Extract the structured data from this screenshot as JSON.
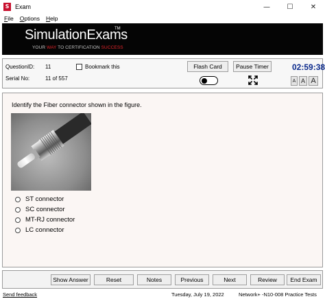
{
  "window": {
    "title": "Exam",
    "app_icon": "S",
    "controls": {
      "minimize": "—",
      "maximize": "☐",
      "close": "✕"
    }
  },
  "menu": {
    "items": [
      {
        "mnemonic": "F",
        "rest": "ile"
      },
      {
        "mnemonic": "O",
        "rest": "ptions"
      },
      {
        "mnemonic": "H",
        "rest": "elp"
      }
    ]
  },
  "banner": {
    "brand": "SimulationExams",
    "trademark": "TM",
    "tagline_part1": "YOUR ",
    "tagline_way": "WAY",
    "tagline_part2": " TO CERTIFICATION ",
    "tagline_success": "SUCCESS",
    "accent_color": "#e8262b"
  },
  "info": {
    "question_id_label": "QuestionID:",
    "question_id_value": "11",
    "serial_label": "Serial No:",
    "serial_value": "11 of 557",
    "bookmark_label": "Bookmark this",
    "bookmark_checked": false,
    "flash_card_label": "Flash Card",
    "pause_timer_label": "Pause Timer",
    "timer": "02:59:38",
    "timer_color": "#0b2a8c",
    "font_sizes": [
      "A",
      "A",
      "A"
    ]
  },
  "question": {
    "text": "Identify the Fiber connector shown in the figure.",
    "image_icon": "fiber-connector-photo",
    "options": [
      {
        "label": "ST connector"
      },
      {
        "label": "SC connector"
      },
      {
        "label": "MT-RJ connector"
      },
      {
        "label": "LC connector"
      }
    ]
  },
  "buttons": {
    "show_answer": "Show Answer",
    "reset": "Reset",
    "notes": "Notes",
    "previous": "Previous",
    "next": "Next",
    "review": "Review",
    "end_exam": "End Exam"
  },
  "status": {
    "feedback": "Send feedback",
    "date": "Tuesday, July 19, 2022",
    "product": "Network+ -N10-008 Practice Tests"
  }
}
